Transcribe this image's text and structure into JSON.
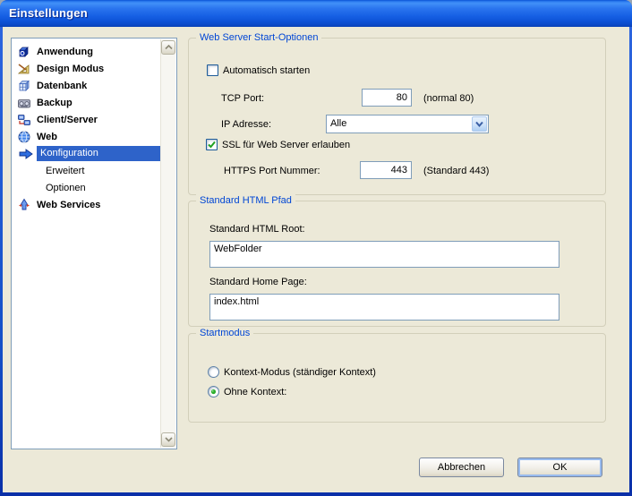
{
  "window": {
    "title": "Einstellungen"
  },
  "colors": {
    "titlebar_blue": "#1761E5",
    "dialog_bg": "#ECE9D8",
    "group_title_blue": "#0046D5",
    "selection_blue": "#2E63C9",
    "field_border": "#7F9DB9",
    "check_green": "#21A121"
  },
  "sidebar": {
    "items": [
      {
        "label": "Anwendung",
        "icon": "app-cube-icon",
        "level": 0,
        "selected": false
      },
      {
        "label": "Design Modus",
        "icon": "design-tools-icon",
        "level": 0,
        "selected": false
      },
      {
        "label": "Datenbank",
        "icon": "database-cube-icon",
        "level": 0,
        "selected": false
      },
      {
        "label": "Backup",
        "icon": "backup-tape-icon",
        "level": 0,
        "selected": false
      },
      {
        "label": "Client/Server",
        "icon": "client-server-icon",
        "level": 0,
        "selected": false
      },
      {
        "label": "Web",
        "icon": "globe-icon",
        "level": 0,
        "selected": false
      },
      {
        "label": "Konfiguration",
        "icon": "selected-arrow-icon",
        "level": 1,
        "selected": true
      },
      {
        "label": "Erweitert",
        "icon": "",
        "level": 1,
        "selected": false
      },
      {
        "label": "Optionen",
        "icon": "",
        "level": 1,
        "selected": false
      },
      {
        "label": "Web Services",
        "icon": "web-services-icon",
        "level": 0,
        "selected": false
      }
    ]
  },
  "groups": {
    "web_server": {
      "title": "Web Server Start-Optionen",
      "autostart_label": "Automatisch starten",
      "autostart_checked": false,
      "tcp_port_label": "TCP Port:",
      "tcp_port_value": "80",
      "tcp_port_hint": "(normal 80)",
      "ip_label": "IP Adresse:",
      "ip_value": "Alle",
      "ssl_label": "SSL für Web Server erlauben",
      "ssl_checked": true,
      "https_label": "HTTPS Port Nummer:",
      "https_value": "443",
      "https_hint": "(Standard 443)"
    },
    "html_path": {
      "title": "Standard HTML Pfad",
      "root_label": "Standard HTML Root:",
      "root_value": "WebFolder",
      "home_label": "Standard Home Page:",
      "home_value": "index.html"
    },
    "startmode": {
      "title": "Startmodus",
      "context_label": "Kontext-Modus (ständiger Kontext)",
      "context_selected": false,
      "no_context_label": "Ohne Kontext:",
      "no_context_selected": true
    }
  },
  "buttons": {
    "cancel": "Abbrechen",
    "ok": "OK"
  }
}
